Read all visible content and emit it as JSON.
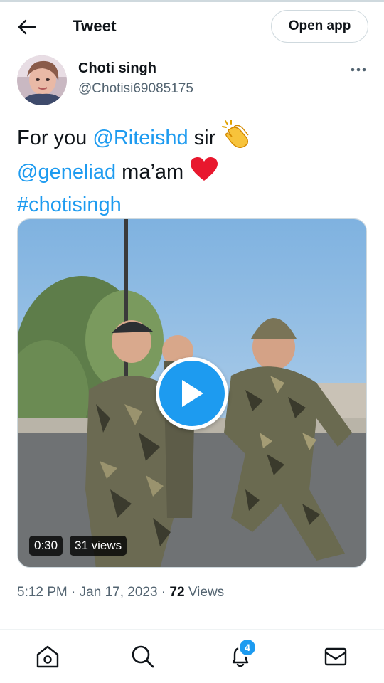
{
  "header": {
    "title": "Tweet",
    "open_app_label": "Open app"
  },
  "author": {
    "display_name": "Choti singh",
    "handle": "@Chotisi69085175"
  },
  "tweet": {
    "part1": "For you ",
    "mention1": "@Riteishd",
    "part2": " sir ",
    "mention2": "@geneliad",
    "part3": " ma’am ",
    "hashtag": "#chotisingh",
    "emoji1": "clapping-hands",
    "emoji2": "red-heart"
  },
  "media": {
    "duration": "0:30",
    "views_label": "31 views",
    "play_button": "play-icon"
  },
  "meta": {
    "time": "5:12 PM",
    "separator1": " · ",
    "date": "Jan 17, 2023",
    "separator2": " · ",
    "views_count": "72",
    "views_label": " Views"
  },
  "nav": {
    "items": [
      "home-icon",
      "search-icon",
      "bell-icon",
      "mail-icon"
    ],
    "notification_badge": "4"
  },
  "colors": {
    "accent": "#1d9bf0",
    "text_primary": "#0f1419",
    "text_secondary": "#536471",
    "border": "#cfd9de"
  }
}
